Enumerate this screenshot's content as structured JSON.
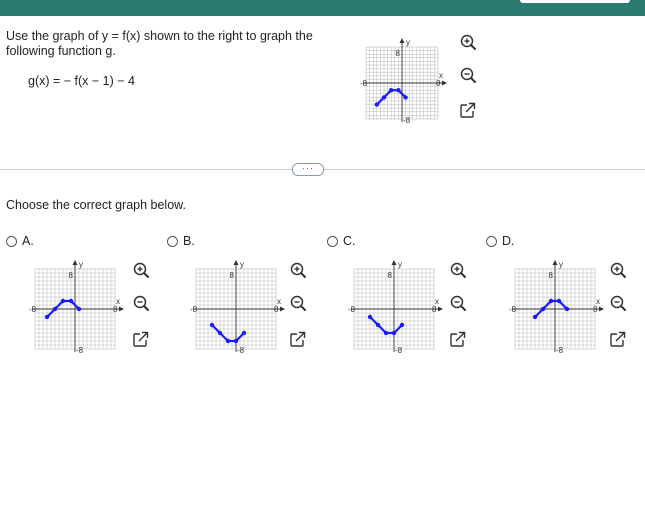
{
  "problem": {
    "instruction": "Use the graph of y = f(x) shown to the right to graph the following function g.",
    "function_text": "g(x) = − f(x − 1) − 4"
  },
  "more_button": {
    "label": "···"
  },
  "prompt": "Choose the correct graph below.",
  "graph_labels": {
    "x_axis": "x",
    "y_axis": "y",
    "min_label": "-8",
    "max_label": "8"
  },
  "tools": {
    "zoom_in": "zoom-in-icon",
    "zoom_out": "zoom-out-icon",
    "expand": "expand-icon"
  },
  "options": [
    {
      "letter": "A.",
      "points": [
        [
          -7,
          -2
        ],
        [
          -5,
          0
        ],
        [
          -3,
          2
        ],
        [
          -1,
          2
        ],
        [
          1,
          0
        ]
      ]
    },
    {
      "letter": "B.",
      "points": [
        [
          -6,
          -4
        ],
        [
          -4,
          -6
        ],
        [
          -2,
          -8
        ],
        [
          0,
          -8
        ],
        [
          2,
          -6
        ]
      ]
    },
    {
      "letter": "C.",
      "points": [
        [
          -6,
          -2
        ],
        [
          -4,
          -4
        ],
        [
          -2,
          -6
        ],
        [
          0,
          -6
        ],
        [
          2,
          -4
        ]
      ]
    },
    {
      "letter": "D.",
      "points": [
        [
          -5,
          -2
        ],
        [
          -3,
          0
        ],
        [
          -1,
          2
        ],
        [
          1,
          2
        ],
        [
          3,
          0
        ]
      ]
    }
  ],
  "reference_graph": {
    "points": [
      [
        -7,
        -6
      ],
      [
        -5,
        -4
      ],
      [
        -3,
        -2
      ],
      [
        -1,
        -2
      ],
      [
        1,
        -4
      ]
    ]
  },
  "colors": {
    "curve": "#1a1aff",
    "grid": "#b8b8b8",
    "axis": "#333333",
    "header": "#2b7a6f"
  }
}
